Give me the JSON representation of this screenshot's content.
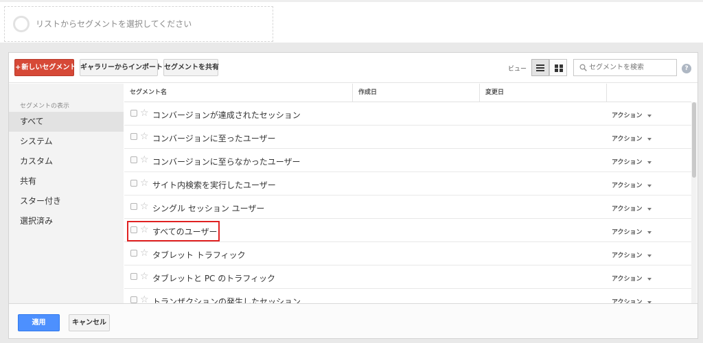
{
  "segment_bar": {
    "placeholder": "リストからセグメントを選択してください"
  },
  "toolbar": {
    "new_segment_label": "新しいセグメント",
    "new_segment_plus": "+",
    "import_label": "ギャラリーからインポート",
    "share_label": "セグメントを共有",
    "view_label": "ビュー",
    "search_placeholder": "セグメントを検索",
    "help_label": "?"
  },
  "sidebar": {
    "heading": "セグメントの表示",
    "items": [
      {
        "label": "すべて",
        "active": true
      },
      {
        "label": "システム"
      },
      {
        "label": "カスタム"
      },
      {
        "label": "共有"
      },
      {
        "label": "スター付き"
      },
      {
        "label": "選択済み"
      }
    ]
  },
  "table": {
    "columns": [
      "セグメント名",
      "作成日",
      "変更日",
      ""
    ],
    "action_label": "アクション",
    "rows": [
      {
        "name": "コンバージョンが達成されたセッション"
      },
      {
        "name": "コンバージョンに至ったユーザー"
      },
      {
        "name": "コンバージョンに至らなかったユーザー"
      },
      {
        "name": "サイト内検索を実行したユーザー"
      },
      {
        "name": "シングル セッション ユーザー"
      },
      {
        "name": "すべてのユーザー",
        "highlighted": true
      },
      {
        "name": "タブレット トラフィック"
      },
      {
        "name": "タブレットと PC のトラフィック"
      },
      {
        "name": "トランザクションの発生したセッション"
      }
    ]
  },
  "footer": {
    "apply_label": "適用",
    "cancel_label": "キャンセル"
  },
  "colors": {
    "primary_red": "#d64937",
    "apply_blue": "#4d90fe",
    "highlight_red": "#e02020"
  },
  "icons": {
    "search": "search-icon",
    "star": "star-icon",
    "help": "help-icon",
    "list_view": "list-view-icon",
    "grid_view": "grid-view-icon"
  }
}
